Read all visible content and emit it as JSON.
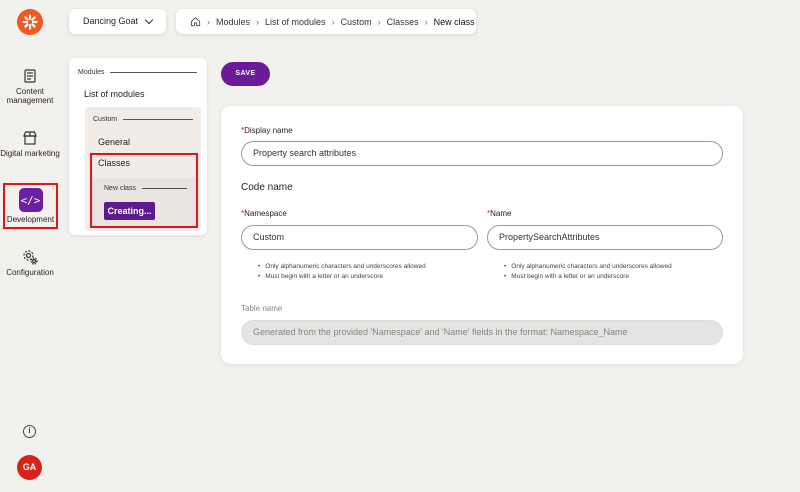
{
  "rail": {
    "items": [
      {
        "label": "Content management"
      },
      {
        "label": "Digital marketing"
      },
      {
        "label": "Development"
      },
      {
        "label": "Configuration"
      }
    ],
    "avatar_initials": "GA"
  },
  "topbar": {
    "site_name": "Dancing Goat",
    "breadcrumb": [
      "Modules",
      "List of modules",
      "Custom",
      "Classes",
      "New class"
    ]
  },
  "tree": {
    "group_modules": "Modules",
    "list_of_modules": "List of modules",
    "group_custom": "Custom",
    "general": "General",
    "classes": "Classes",
    "group_new_class": "New class",
    "creating": "Creating..."
  },
  "toolbar": {
    "save_label": "SAVE"
  },
  "form": {
    "display_name_label": "Display name",
    "display_name_value": "Property search attributes",
    "code_name_heading": "Code name",
    "namespace_label": "Namespace",
    "namespace_value": "Custom",
    "name_label": "Name",
    "name_value": "PropertySearchAttributes",
    "hints": [
      "Only alphanumeric characters and underscores allowed",
      "Must begin with a letter or an underscore"
    ],
    "table_name_label": "Table name",
    "table_name_placeholder": "Generated from the provided 'Namespace' and 'Name' fields in the format: Namespace_Name"
  },
  "colors": {
    "accent": "#6a1b9a",
    "highlight": "#e0141b",
    "brand": "#f05a22"
  }
}
